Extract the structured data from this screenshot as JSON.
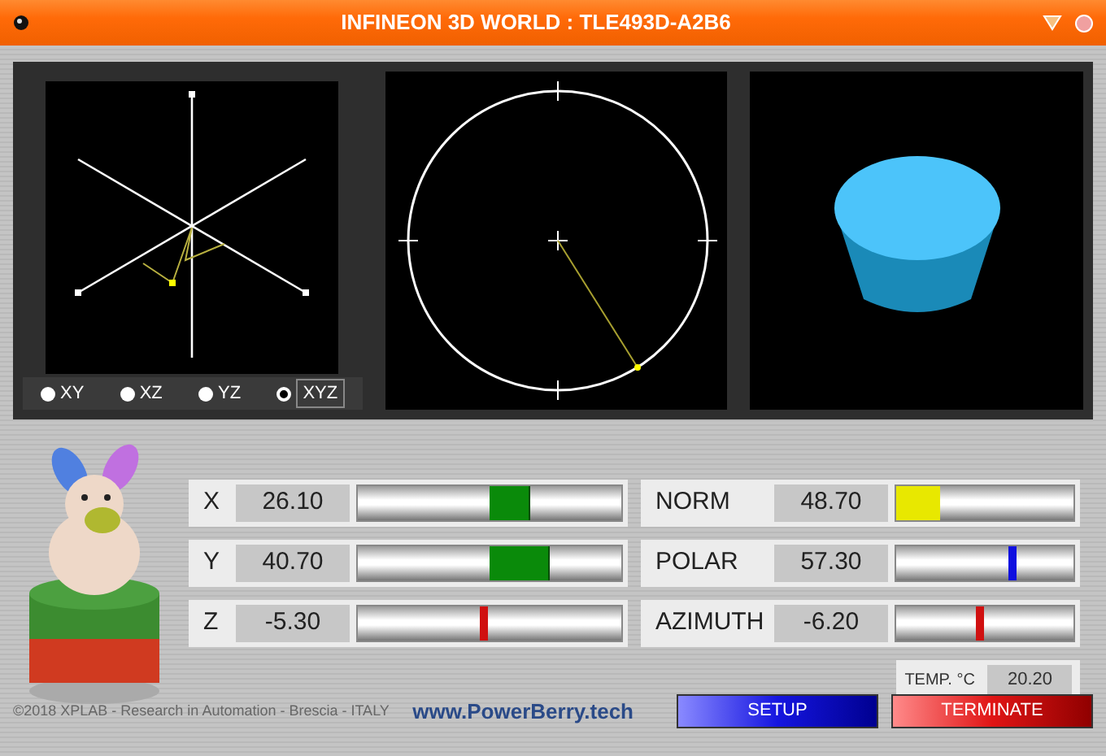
{
  "window": {
    "title": "INFINEON 3D WORLD : TLE493D-A2B6"
  },
  "views": [
    {
      "label": "XY",
      "selected": false
    },
    {
      "label": "XZ",
      "selected": false
    },
    {
      "label": "YZ",
      "selected": false
    },
    {
      "label": "XYZ",
      "selected": true
    }
  ],
  "gauges": [
    {
      "name": "X",
      "value": "26.10",
      "kind": "center",
      "level": 0.65,
      "color": "#0a8a0a"
    },
    {
      "name": "Y",
      "value": "40.70",
      "kind": "center",
      "level": 0.72,
      "color": "#0a8a0a"
    },
    {
      "name": "Z",
      "value": "-5.30",
      "kind": "marker",
      "level": 0.48,
      "color": "#d01010"
    },
    {
      "name": "NORM",
      "value": "48.70",
      "kind": "left",
      "level": 0.25,
      "color": "#e8e800"
    },
    {
      "name": "POLAR",
      "value": "57.30",
      "kind": "marker",
      "level": 0.66,
      "color": "#1010e0"
    },
    {
      "name": "AZIMUTH",
      "value": "-6.20",
      "kind": "marker",
      "level": 0.48,
      "color": "#d01010"
    }
  ],
  "temperature": {
    "label": "TEMP. °C",
    "value": "20.20"
  },
  "footer": {
    "copyright": "©2018 XPLAB - Research in Automation - Brescia - ITALY",
    "website": "www.PowerBerry.tech"
  },
  "buttons": [
    {
      "label": "SETUP",
      "kind": "setup"
    },
    {
      "label": "TERMINATE",
      "kind": "terminate"
    }
  ]
}
